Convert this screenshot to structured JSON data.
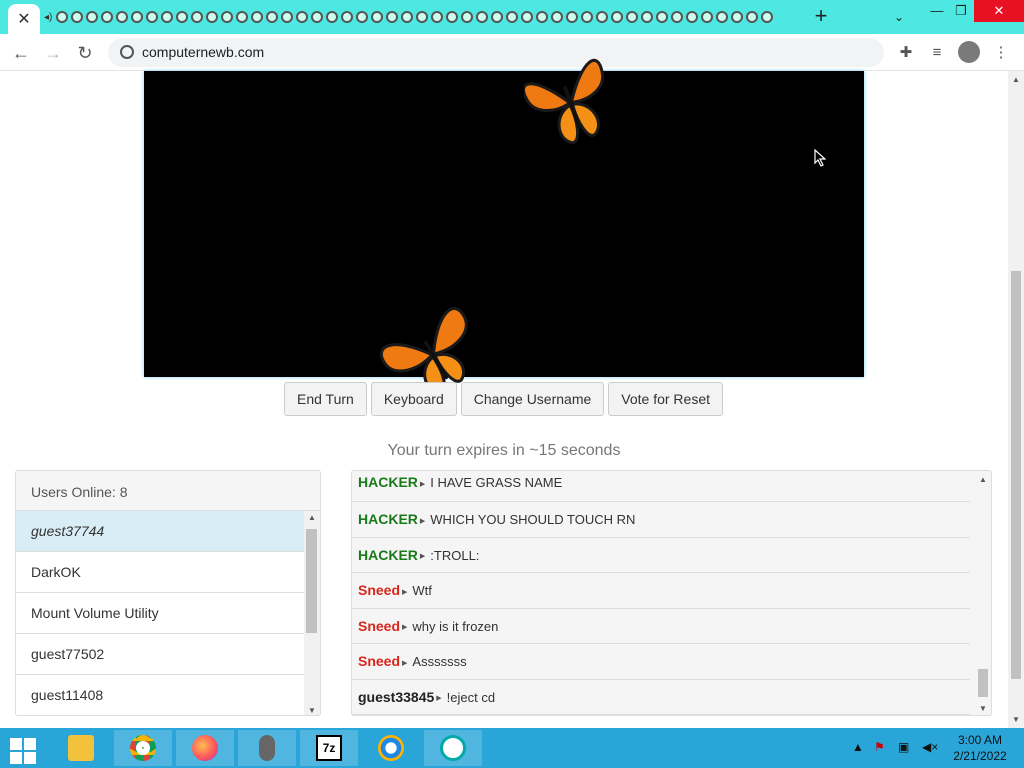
{
  "browser": {
    "tab_close": "✕",
    "tab_row_icon": "tab-favicon-icon",
    "new_tab": "+",
    "tab_search": "⌄",
    "minimize": "—",
    "maximize": "❐",
    "close": "✕",
    "url": "computernewb.com"
  },
  "vm": {
    "buttons": {
      "end_turn": "End Turn",
      "keyboard": "Keyboard",
      "change_username": "Change Username",
      "vote_reset": "Vote for Reset"
    },
    "turn_message": "Your turn expires in ~15 seconds"
  },
  "users": {
    "heading": "Users Online: 8",
    "list": [
      "guest37744",
      "DarkOK",
      "Mount Volume Utility",
      "guest77502",
      "guest11408"
    ]
  },
  "chat": {
    "messages": [
      {
        "user": "HACKER",
        "text": "I HAVE GRASS NAME",
        "color": "#1a7a1a"
      },
      {
        "user": "HACKER",
        "text": "WHICH YOU SHOULD TOUCH RN",
        "color": "#1a7a1a"
      },
      {
        "user": "HACKER",
        "text": ":TROLL:",
        "color": "#1a7a1a"
      },
      {
        "user": "Sneed",
        "text": "Wtf",
        "color": "#d9261c"
      },
      {
        "user": "Sneed",
        "text": "why is it frozen",
        "color": "#d9261c"
      },
      {
        "user": "Sneed",
        "text": "Asssssss",
        "color": "#d9261c"
      },
      {
        "user": "guest33845",
        "text": "!eject cd",
        "color": "#222222"
      }
    ]
  },
  "taskbar": {
    "apps": [
      "file-explorer-icon",
      "chrome-icon",
      "firefox-icon",
      "mouse-icon",
      "7zip-icon",
      "browser-icon",
      "accessibility-icon"
    ],
    "time": "3:00 AM",
    "date": "2/21/2022",
    "seven_zip_label": "7z"
  },
  "colors": {
    "tab_strip": "#4ee8e2",
    "taskbar": "#2aa5d8",
    "hacker": "#1a7a1a",
    "sneed": "#d9261c"
  }
}
